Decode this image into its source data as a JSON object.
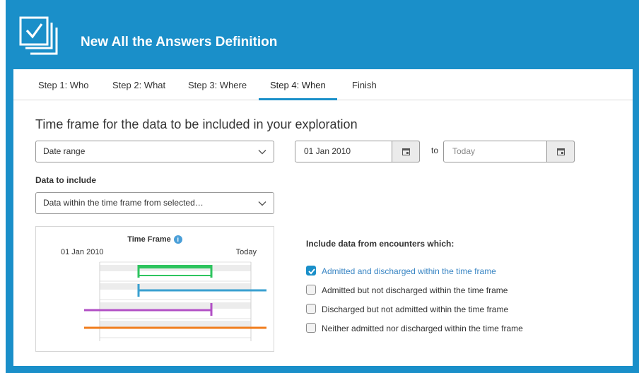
{
  "header": {
    "title": "New All the Answers Definition",
    "icon": "checklist-icon"
  },
  "tabs": [
    {
      "label": "Step 1: Who",
      "active": false
    },
    {
      "label": "Step 2: What",
      "active": false
    },
    {
      "label": "Step 3: Where",
      "active": false
    },
    {
      "label": "Step 4: When",
      "active": true
    },
    {
      "label": "Finish",
      "active": false
    }
  ],
  "main": {
    "section_title": "Time frame for the data to be included in your exploration",
    "range_select": {
      "value": "Date range"
    },
    "date_from": {
      "value": "01 Jan 2010"
    },
    "to_label": "to",
    "date_to": {
      "placeholder": "Today"
    },
    "data_to_include_label": "Data to include",
    "include_select": {
      "value": "Data within the time frame from selected…"
    }
  },
  "timeframe": {
    "title": "Time Frame",
    "start_label": "01 Jan 2010",
    "end_label": "Today"
  },
  "include": {
    "title": "Include data from encounters which:",
    "options": [
      {
        "label": "Admitted and discharged within the time frame",
        "checked": true
      },
      {
        "label": "Admitted but not discharged within the time frame",
        "checked": false
      },
      {
        "label": "Discharged but not admitted within the time frame",
        "checked": false
      },
      {
        "label": "Neither admitted nor discharged within the time frame",
        "checked": false
      }
    ]
  },
  "colors": {
    "brand": "#1a8fc9",
    "green": "#2ec45f",
    "blue": "#3aa0d0",
    "purple": "#b14fc5",
    "orange": "#f07d1c"
  }
}
